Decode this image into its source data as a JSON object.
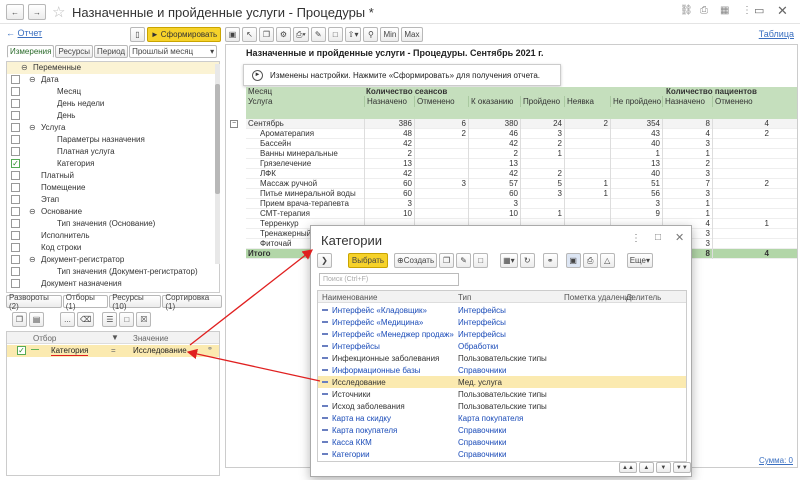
{
  "window": {
    "title": "Назначенные и пройденные услуги - Процедуры *"
  },
  "toolbar": {
    "back_link": "Отчет",
    "form_button": "Сформировать",
    "min_label": "Min",
    "max_label": "Max",
    "table_link": "Таблица"
  },
  "left": {
    "tabs": [
      "Измерения",
      "Ресурсы",
      "Период"
    ],
    "period_value": "Прошлый месяц",
    "tree": [
      {
        "label": "Переменные",
        "indent": 2,
        "check": null,
        "exp": "minus"
      },
      {
        "label": "Дата",
        "indent": 3,
        "check": false,
        "exp": "minus"
      },
      {
        "label": "Месяц",
        "indent": 5,
        "check": false,
        "exp": null
      },
      {
        "label": "День недели",
        "indent": 5,
        "check": false,
        "exp": null
      },
      {
        "label": "День",
        "indent": 5,
        "check": false,
        "exp": null
      },
      {
        "label": "Услуга",
        "indent": 3,
        "check": false,
        "exp": "minus"
      },
      {
        "label": "Параметры назначения",
        "indent": 5,
        "check": false,
        "exp": null
      },
      {
        "label": "Платная услуга",
        "indent": 5,
        "check": false,
        "exp": null
      },
      {
        "label": "Категория",
        "indent": 5,
        "check": true,
        "exp": null
      },
      {
        "label": "Платный",
        "indent": 3,
        "check": false,
        "exp": null
      },
      {
        "label": "Помещение",
        "indent": 3,
        "check": false,
        "exp": null
      },
      {
        "label": "Этап",
        "indent": 3,
        "check": false,
        "exp": null
      },
      {
        "label": "Основание",
        "indent": 3,
        "check": false,
        "exp": "minus"
      },
      {
        "label": "Тип значения (Основание)",
        "indent": 5,
        "check": false,
        "exp": null
      },
      {
        "label": "Исполнитель",
        "indent": 3,
        "check": false,
        "exp": null
      },
      {
        "label": "Код строки",
        "indent": 3,
        "check": false,
        "exp": null
      },
      {
        "label": "Документ-регистратор",
        "indent": 3,
        "check": false,
        "exp": "minus"
      },
      {
        "label": "Тип значения (Документ-регистратор)",
        "indent": 5,
        "check": false,
        "exp": null
      },
      {
        "label": "Документ назначения",
        "indent": 3,
        "check": false,
        "exp": null
      }
    ],
    "bottom_tabs": [
      "Развороты (2)",
      "Отборы (1)",
      "Ресурсы (10)",
      "Сортировка (1)"
    ],
    "filter_headers": {
      "filter": "Отбор",
      "value": "Значение"
    },
    "filter_row": {
      "field": "Категория",
      "op": "=",
      "value": "Исследование"
    }
  },
  "report": {
    "title": "Назначенные и пройденные услуги - Процедуры. Сентябрь 2021 г.",
    "notice": "Изменены настройки. Нажмите «Сформировать» для получения отчета.",
    "h1": {
      "month": "Месяц",
      "sessions": "Количество сеансов",
      "patients": "Количество пациентов"
    },
    "h2": {
      "service": "Услуга",
      "assigned": "Назначено",
      "canceled": "Отменено",
      "to_show": "К оказанию",
      "passed": "Пройдено",
      "noshow": "Неявка",
      "not_passed": "Не пройдено",
      "p_assigned": "Назначено",
      "p_canceled": "Отменено"
    },
    "group": {
      "label": "Сентябрь",
      "values": [
        "386",
        "6",
        "380",
        "24",
        "2",
        "354",
        "8",
        "4"
      ]
    },
    "rows": [
      {
        "name": "Ароматерапия",
        "values": [
          "48",
          "2",
          "46",
          "3",
          "",
          "43",
          "4",
          "2"
        ]
      },
      {
        "name": "Бассейн",
        "values": [
          "42",
          "",
          "42",
          "2",
          "",
          "40",
          "3",
          ""
        ]
      },
      {
        "name": "Ванны минеральные",
        "values": [
          "2",
          "",
          "2",
          "1",
          "",
          "1",
          "1",
          ""
        ]
      },
      {
        "name": "Грязелечение",
        "values": [
          "13",
          "",
          "13",
          "",
          "",
          "13",
          "2",
          ""
        ]
      },
      {
        "name": "ЛФК",
        "values": [
          "42",
          "",
          "42",
          "2",
          "",
          "40",
          "3",
          ""
        ]
      },
      {
        "name": "Массаж ручной",
        "values": [
          "60",
          "3",
          "57",
          "5",
          "1",
          "51",
          "7",
          "2"
        ]
      },
      {
        "name": "Питье минеральной воды",
        "values": [
          "60",
          "",
          "60",
          "3",
          "1",
          "56",
          "3",
          ""
        ]
      },
      {
        "name": "Прием врача-терапевта",
        "values": [
          "3",
          "",
          "3",
          "",
          "",
          "3",
          "1",
          ""
        ]
      },
      {
        "name": "СМТ-терапия",
        "values": [
          "10",
          "",
          "10",
          "1",
          "",
          "9",
          "1",
          ""
        ]
      },
      {
        "name": "Терренкур",
        "values": [
          "",
          "",
          "",
          "",
          "",
          "",
          "4",
          "1"
        ]
      },
      {
        "name": "Тренажерный",
        "values": [
          "",
          "",
          "",
          "",
          "",
          "",
          "3",
          ""
        ]
      },
      {
        "name": "Фиточай",
        "values": [
          "",
          "",
          "",
          "",
          "",
          "",
          "3",
          ""
        ]
      }
    ],
    "total": {
      "label": "Итого",
      "values": [
        "",
        "",
        "",
        "",
        "",
        "",
        "8",
        "4"
      ]
    },
    "sum_label": "Сумма: 0"
  },
  "dialog": {
    "title": "Категории",
    "select_button": "Выбрать",
    "create_button": "Создать",
    "more_button": "Еще",
    "search_placeholder": "Поиск (Ctrl+F)",
    "columns": [
      "Наименование",
      "Тип",
      "Пометка удаления",
      "Делитель"
    ],
    "rows": [
      {
        "name": "Интерфейс «Кладовщик»",
        "type": "Интерфейсы",
        "blue": true,
        "selected": false
      },
      {
        "name": "Интерфейс «Медицина»",
        "type": "Интерфейсы",
        "blue": true,
        "selected": false
      },
      {
        "name": "Интерфейс «Менеджер продаж»",
        "type": "Интерфейсы",
        "blue": true,
        "selected": false
      },
      {
        "name": "Интерфейсы",
        "type": "Обработки",
        "blue": true,
        "selected": false
      },
      {
        "name": "Инфекционные заболевания",
        "type": "Пользовательские типы",
        "blue": false,
        "selected": false
      },
      {
        "name": "Информационные базы",
        "type": "Справочники",
        "blue": true,
        "selected": false
      },
      {
        "name": "Исследование",
        "type": "Мед. услуга",
        "blue": false,
        "selected": true
      },
      {
        "name": "Источники",
        "type": "Пользовательские типы",
        "blue": false,
        "selected": false
      },
      {
        "name": "Исход заболевания",
        "type": "Пользовательские типы",
        "blue": false,
        "selected": false
      },
      {
        "name": "Карта на скидку",
        "type": "Карта покупателя",
        "blue": true,
        "selected": false
      },
      {
        "name": "Карта покупателя",
        "type": "Справочники",
        "blue": true,
        "selected": false
      },
      {
        "name": "Касса ККМ",
        "type": "Справочники",
        "blue": true,
        "selected": false
      },
      {
        "name": "Категории",
        "type": "Справочники",
        "blue": true,
        "selected": false
      }
    ]
  },
  "colors": {
    "accent": "#f5d21c",
    "header_green": "#c5dfbd",
    "total_green": "#b2d6a8",
    "selected_row": "#fbeab0",
    "link_blue": "#1a4bb8",
    "arrow_red": "#e02020"
  }
}
